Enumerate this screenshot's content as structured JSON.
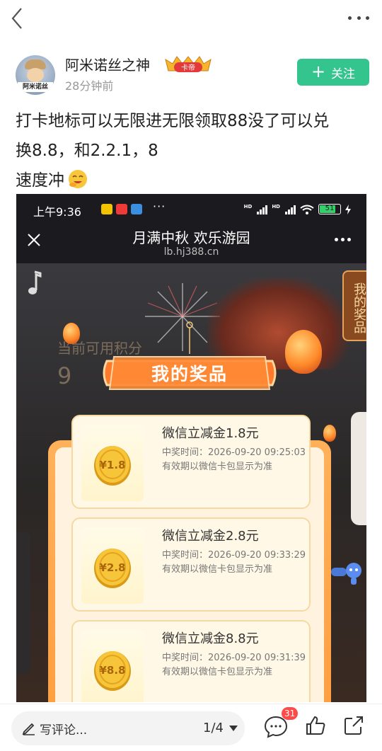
{
  "post": {
    "author_name": "阿米诺丝之神",
    "avatar_text": "阿米诺丝",
    "badge_text": "卡帝",
    "time": "28分钟前",
    "follow_label": "关注",
    "text_line1": "打卡地标可以无限进无限领取88没了可以兑",
    "text_line2": "换8.8，和2.2.1，8",
    "text_line3": "速度冲"
  },
  "screenshot": {
    "status_time": "上午9:36",
    "status_dots": "···",
    "hd1": "HD",
    "hd2": "HD",
    "battery": "51",
    "page_title": "月满中秋 欢乐游园",
    "page_url": "lb.hj388.cn",
    "side_prizes_label": "我的奖品",
    "points_label": "当前可用积分",
    "points_value": "9",
    "modal_title": "我的奖品",
    "prizes": [
      {
        "coin": "¥1.8",
        "title": "微信立减金1.8元",
        "time": "中奖时间：2026-09-20 09:25:03",
        "validity": "有效期以微信卡包显示为准"
      },
      {
        "coin": "¥2.8",
        "title": "微信立减金2.8元",
        "time": "中奖时间：2026-09-20 09:33:29",
        "validity": "有效期以微信卡包显示为准"
      },
      {
        "coin": "¥8.8",
        "title": "微信立减金8.8元",
        "time": "中奖时间：2026-09-20 09:31:39",
        "validity": "有效期以微信卡包显示为准"
      }
    ]
  },
  "bottom": {
    "comment_placeholder": "写评论...",
    "page_indicator": "1/4",
    "comment_count": "31"
  },
  "colors": {
    "follow_green": "#33c58d",
    "badge_red": "#ff4a4a",
    "modal_orange": "#ff9a3c"
  },
  "icons": [
    "back-icon",
    "more-icon",
    "emoji-icon",
    "close-icon",
    "music-icon",
    "pencil-icon",
    "comment-icon",
    "like-icon",
    "share-icon"
  ]
}
